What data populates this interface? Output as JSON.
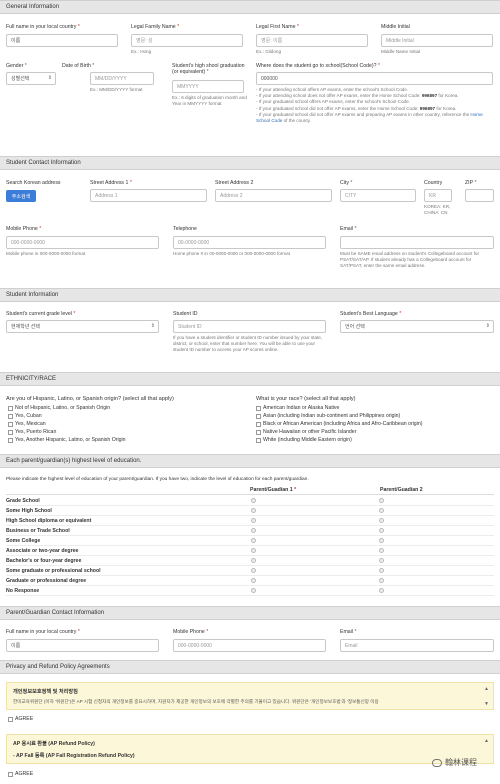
{
  "general": {
    "header": "General Information",
    "full_name_label": "Full name in your local country",
    "full_name_value": "이름",
    "family_name_label": "Legal Family Name",
    "family_name_value": "영문: 성",
    "family_name_help": "Ex.: Hong",
    "first_name_label": "Legal First Name",
    "first_name_value": "영문: 이름",
    "first_name_help": "Ex.: Gildong",
    "middle_initial_label": "Middle Initial",
    "middle_initial_value": "Middle Initial",
    "middle_name_help": "Middle Name Initial",
    "gender_label": "Gender",
    "gender_value": "성별선택",
    "dob_label": "Date of Birth",
    "dob_placeholder": "MM/DD/YYYY",
    "dob_help": "Ex.: MM/DD/YYYY format",
    "grad_label": "Student's high shool graduation (or equivalent)",
    "grad_placeholder": "MMYYYY",
    "grad_help": "Ex.: 6 digits of graduation month and Year in MMYYYY format",
    "school_label": "Where does the student go to school(School Code)?",
    "school_value": "000000",
    "school_help1": "- If your attending school offers AP exams, enter the school's School Code.",
    "school_help2a": "- If your attending school does not offer AP exams, enter the Home School Code: ",
    "school_help2b": "996897",
    "school_help2c": " for Korea.",
    "school_help3": "- If your graduated school offers AP exams, enter the school's School Code.",
    "school_help4a": "- If your graduated school did not offer AP exams, enter the Home School Code: ",
    "school_help4b": "996897",
    "school_help4c": " for Korea.",
    "school_help5a": "- If your graduated school did not offer AP exams and preparing AP exams in other country, reference the ",
    "school_help5b": "Home School Code",
    "school_help5c": " of the county."
  },
  "contact": {
    "header": "Student Contact Information",
    "search_label": "Search Korean address",
    "search_button": "주소검색",
    "street1_label": "Street Address 1",
    "street1_placeholder": "Address 1",
    "street2_label": "Street Address 2",
    "street2_placeholder": "Address 2",
    "city_label": "City",
    "city_placeholder": "CITY",
    "country_label": "Country",
    "country_value": "KR",
    "country_help": "KOREA: KR, CHINA: CN",
    "zip_label": "ZIP",
    "mobile_label": "Mobile Phone",
    "mobile_placeholder": "000-0000-0000",
    "mobile_help": "Mobile phone in 000-0000-0000 format",
    "tel_label": "Telephone",
    "tel_placeholder": "00-0000-0000",
    "tel_help": "Home phone # in 00-0000-0000 or 000-0000-0000 format",
    "email_label": "Email",
    "email_help": "Must be SAME email address on student's Collegeboard account for PSAT/SAT/AP. If student already has a Collegeboard account for SAT/PSAT, enter the same email address."
  },
  "student": {
    "header": "Student Information",
    "grade_label": "Student's current grade level",
    "grade_value": "현재학년 선택",
    "id_label": "Student ID",
    "id_placeholder": "Student ID",
    "id_help": "If you have a student identifier or student ID number issued by your state, district, or school, enter that number here. You will be able to use your student ID number to access your AP scores online.",
    "lang_label": "Student's Best Language",
    "lang_value": "언어 선택"
  },
  "ethnicity": {
    "header": "ETHNICITY/RACE",
    "hispanic_q": "Are you of Hispanic, Latino, or Spanish origin? (select all that apply)",
    "hispanic_opts": [
      "Not of Hispanic, Latino, or Spanish Origin",
      "Yes, Cuban",
      "Yes, Mexican",
      "Yes, Puerto Rican",
      "Yes, Another Hispanic, Latino, or Spanish Origin"
    ],
    "race_q": "What is your race? (select all that apply)",
    "race_opts": [
      "American Indian or Alaska Native",
      "Asian (including Indian sub-continent and Philippines origin)",
      "Black or African American (including Africa and Afro-Caribbean origin)",
      "Native Hawaiian or other Pacific Islander",
      "White (including Middle Eastern origin)"
    ]
  },
  "education": {
    "header": "Each parent/guardian(s) highest level of education.",
    "instruction": "Please indicate the highest level of education of your parent/guardian. If you have two, indicate the level of education for each parent/guardian.",
    "col1": "Parent/Guadian 1",
    "col2": "Parent/Guadian 2",
    "levels": [
      "Grade School",
      "Some High School",
      "High School diploma or equivalent",
      "Business or Trade School",
      "Some College",
      "Associate or two-year degree",
      "Bachelor's or four-year degree",
      "Some graduate or professional school",
      "Graduate or professional degree",
      "No Response"
    ]
  },
  "parent": {
    "header": "Parent/Guardian Contact Information",
    "name_label": "Full name in your local country",
    "name_value": "이름",
    "mobile_label": "Mobile Phone",
    "mobile_placeholder": "000-0000-0000",
    "email_label": "Email",
    "email_placeholder": "Email"
  },
  "privacy": {
    "header": "Privacy and Refund Policy Agreements",
    "notice1_title": "개인정보보호정책 및 처리방침",
    "notice1_text": "한미교육위원단 (이하 '위원단')은 AP 시험 신청자의 개인정보를 중요시하며, 지원자가 제공한 개인정보의 보호에 각별한 주의를 기울이고 있습니다. 위원단은 '개인정보보호법'과 '정보통신망 이용",
    "agree1": "AGREE",
    "notice2_title": "AP 응시료 환불 (AP Refund Policy)",
    "notice2_sub": "- AP Fall 등록 (AP Fall Registration Refund Policy)",
    "agree2": "AGREE",
    "watermark": "翰林课程"
  },
  "colors": {
    "accent": "#3b7dd8",
    "required": "#c0392b",
    "section_bg": "#e6e6e6",
    "notice_bg": "#fdf7d9"
  }
}
